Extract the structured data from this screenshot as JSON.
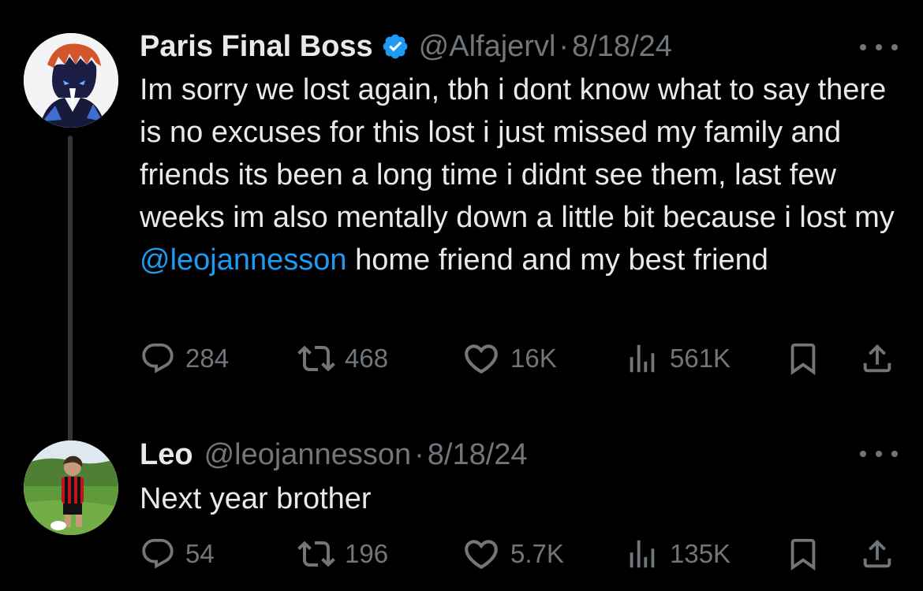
{
  "tweets": [
    {
      "name": "Paris Final Boss",
      "verified": true,
      "handle": "@Alfajervl",
      "separator": "·",
      "date": "8/18/24",
      "text_before": "Im sorry we lost again, tbh i dont know what to say there is no excuses for this lost i just missed my family and friends its been a long time i didnt see them, last few weeks im also mentally down a little bit because i lost my ",
      "mention": "@leojannesson",
      "text_after": " home friend and my best friend",
      "stats": {
        "replies": "284",
        "reposts": "468",
        "likes": "16K",
        "views": "561K"
      }
    },
    {
      "name": "Leo",
      "verified": false,
      "handle": "@leojannesson",
      "separator": "·",
      "date": "8/18/24",
      "text": "Next year brother",
      "stats": {
        "replies": "54",
        "reposts": "196",
        "likes": "5.7K",
        "views": "135K"
      }
    }
  ],
  "colors": {
    "background": "#000000",
    "text": "#e7e9ea",
    "muted": "#71767b",
    "accent": "#1d9bf0",
    "thread_line": "#333639"
  },
  "icons": [
    "reply-icon",
    "repost-icon",
    "like-icon",
    "views-icon",
    "bookmark-icon",
    "share-icon",
    "more-icon",
    "verified-badge-icon"
  ]
}
